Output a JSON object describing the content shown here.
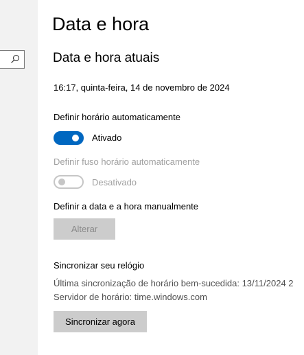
{
  "window": {
    "page_title": "Data e hora"
  },
  "sidebar": {
    "search_icon": "search-icon"
  },
  "current": {
    "section_title": "Data e hora atuais",
    "datetime": "16:17, quinta-feira, 14 de novembro de 2024"
  },
  "auto_time": {
    "label": "Definir horário automaticamente",
    "state": "Ativado",
    "enabled": true
  },
  "auto_timezone": {
    "label": "Definir fuso horário automaticamente",
    "state": "Desativado",
    "enabled": false,
    "disabled": true
  },
  "manual": {
    "label": "Definir a data e a hora manualmente",
    "button": "Alterar",
    "button_disabled": true
  },
  "sync": {
    "title": "Sincronizar seu relógio",
    "last_sync": "Última sincronização de horário bem-sucedida: 13/11/2024 2",
    "server": "Servidor de horário: time.windows.com",
    "button": "Sincronizar agora"
  },
  "colors": {
    "accent": "#0067c0",
    "sidebar_bg": "#f2f2f2",
    "button_bg": "#cccccc",
    "disabled_text": "#a0a0a0"
  }
}
